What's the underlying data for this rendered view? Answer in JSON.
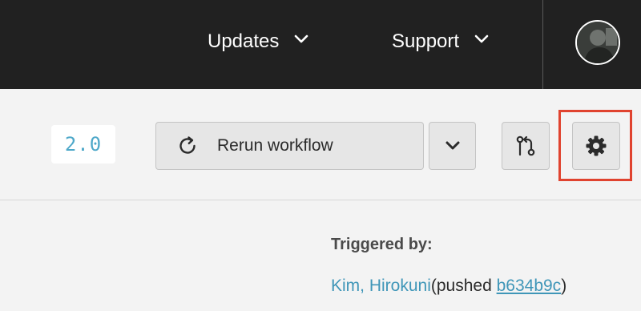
{
  "nav": {
    "updates_label": "Updates",
    "support_label": "Support"
  },
  "toolbar": {
    "version": "2.0",
    "rerun_label": "Rerun workflow"
  },
  "trigger": {
    "heading": "Triggered by:",
    "author": "Kim, Hirokuni",
    "pushed_prefix": "(pushed ",
    "commit": "b634b9c",
    "pushed_suffix": ")"
  },
  "colors": {
    "topbar": "#212121",
    "accent_link": "#3f96b8",
    "version_text": "#4ea8c9",
    "highlight": "#e0432f"
  },
  "icons": {
    "updates_chevron": "chevron-down-icon",
    "support_chevron": "chevron-down-icon",
    "rerun": "refresh-icon",
    "dropdown": "chevron-down-icon",
    "compare": "git-compare-icon",
    "settings": "gear-icon"
  }
}
